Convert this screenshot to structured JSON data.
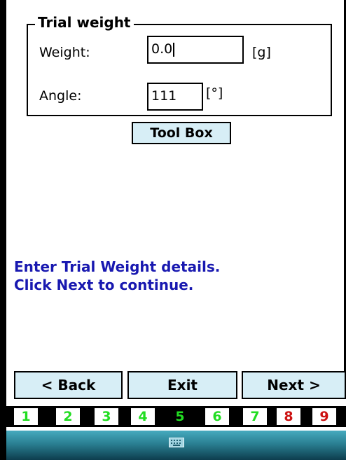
{
  "group": {
    "title": "Trial weight"
  },
  "weight": {
    "label": "Weight:",
    "value": "0.0",
    "unit": "[g]"
  },
  "angle": {
    "label": "Angle:",
    "value": "111",
    "unit": "[°]"
  },
  "toolbox_label": "Tool Box",
  "message": {
    "line1": "Enter Trial Weight details.",
    "line2": "Click Next to continue."
  },
  "nav": {
    "back": "< Back",
    "exit": "Exit",
    "next": "Next >"
  },
  "steps": [
    {
      "label": "1",
      "color": "#22dd22",
      "active": false
    },
    {
      "label": "2",
      "color": "#22dd22",
      "active": false
    },
    {
      "label": "3",
      "color": "#22dd22",
      "active": false
    },
    {
      "label": "4",
      "color": "#22dd22",
      "active": false
    },
    {
      "label": "5",
      "color": "#22dd22",
      "active": true
    },
    {
      "label": "6",
      "color": "#22dd22",
      "active": false
    },
    {
      "label": "7",
      "color": "#22dd22",
      "active": false
    },
    {
      "label": "8",
      "color": "#cc1111",
      "active": false
    },
    {
      "label": "9",
      "color": "#cc1111",
      "active": false
    }
  ],
  "taskbar": {
    "keyboard_icon": "keyboard-icon"
  }
}
